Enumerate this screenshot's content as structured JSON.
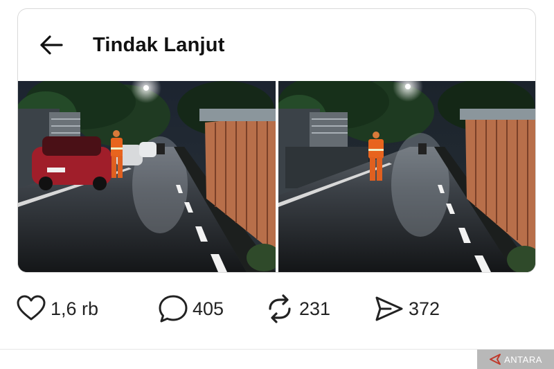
{
  "header": {
    "back_label": "Back",
    "title": "Tindak Lanjut"
  },
  "media": {
    "photos": [
      {
        "description_icon": "photo-night-street-with-car-icon"
      },
      {
        "description_icon": "photo-night-street-icon"
      }
    ]
  },
  "actions": {
    "like": {
      "icon": "heart-icon",
      "count": "1,6 rb"
    },
    "reply": {
      "icon": "speech-bubble-icon",
      "count": "405"
    },
    "repost": {
      "icon": "repost-arrows-icon",
      "count": "231"
    },
    "share": {
      "icon": "paper-plane-icon",
      "count": "372"
    }
  },
  "watermark": {
    "text": "ANTARA"
  },
  "colors": {
    "title_text": "#111111",
    "count_text": "#222222",
    "card_border": "#d9d9d9",
    "worker_uniform": "#e8641e",
    "fence": "#b86f4a"
  }
}
